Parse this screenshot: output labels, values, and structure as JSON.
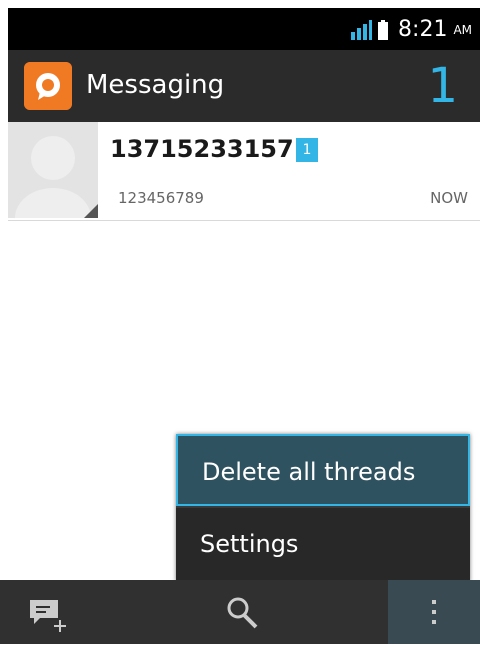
{
  "status_bar": {
    "time": "8:21",
    "ampm": "AM",
    "signal_icon": "signal-icon",
    "battery_icon": "battery-icon"
  },
  "action_bar": {
    "title": "Messaging",
    "unread_total": "1",
    "icon": "messaging-app-icon"
  },
  "threads": [
    {
      "name": "13715233157",
      "unread_count": "1",
      "snippet": "123456789",
      "time": "NOW"
    }
  ],
  "overflow_menu": {
    "items": [
      {
        "label": "Delete all threads"
      },
      {
        "label": "Settings"
      }
    ]
  },
  "bottom_bar": {
    "items": [
      "compose-icon",
      "search-icon",
      "overflow-icon"
    ]
  },
  "colors": {
    "accent": "#33b5e5",
    "app_icon": "#f07a23",
    "action_bar": "#2b2b2b"
  }
}
